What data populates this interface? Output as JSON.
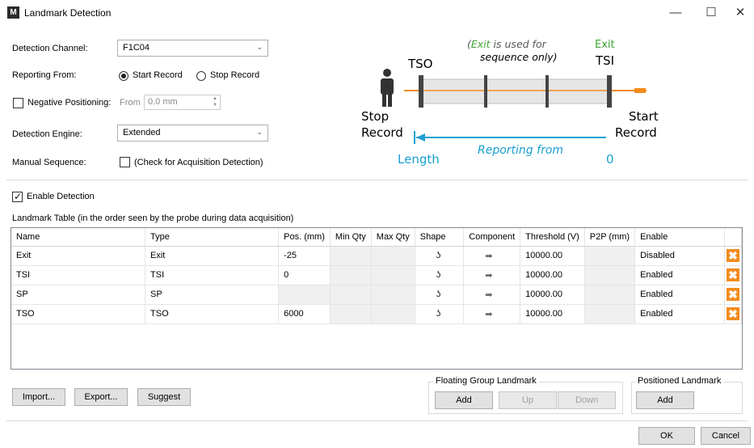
{
  "window": {
    "title": "Landmark Detection",
    "icon_glyph": "M",
    "controls": {
      "minimize": "—",
      "maximize": "☐",
      "close": "✕"
    }
  },
  "form": {
    "detection_channel": {
      "label": "Detection Channel:",
      "value": "F1C04"
    },
    "reporting_from": {
      "label": "Reporting From:",
      "options": [
        "Start Record",
        "Stop Record"
      ],
      "selected": "Start Record"
    },
    "negative_positioning": {
      "label": "Negative Positioning:",
      "checked": false,
      "from_label": "From",
      "value": "0.0 mm"
    },
    "detection_engine": {
      "label": "Detection Engine:",
      "value": "Extended"
    },
    "manual_sequence": {
      "label": "Manual Sequence:",
      "checkbox_label": "(Check for Acquisition Detection)",
      "checked": false
    }
  },
  "diagram": {
    "exit_note_1": "is used for",
    "exit_note_exit": "Exit",
    "exit_note_2": "sequence only)",
    "tso": "TSO",
    "tsi": "TSI",
    "exit": "Exit",
    "stop": "Stop",
    "stop_record": "Record",
    "start": "Start",
    "start_record": "Record",
    "reporting_from": "Reporting from",
    "length": "Length",
    "zero": "0",
    "colors": {
      "exit_green": "#3fa535",
      "cable_orange": "#f28b1e",
      "measure_blue": "#1a9fd0"
    }
  },
  "enable_detection": {
    "label": "Enable Detection",
    "checked": true
  },
  "table": {
    "caption": "Landmark Table (in the order seen by the probe during data acquisition)",
    "columns": [
      "Name",
      "Type",
      "Pos. (mm)",
      "Min Qty",
      "Max Qty",
      "Shape",
      "Component",
      "Threshold (V)",
      "P2P (mm)",
      "Enable"
    ],
    "rows": [
      {
        "name": "Exit",
        "type": "Exit",
        "pos": "-25",
        "min": "",
        "max": "",
        "threshold": "10000.00",
        "p2p": "",
        "enable": "Disabled"
      },
      {
        "name": "TSI",
        "type": "TSI",
        "pos": "0",
        "min": "",
        "max": "",
        "threshold": "10000.00",
        "p2p": "",
        "enable": "Enabled"
      },
      {
        "name": "SP",
        "type": "SP",
        "pos": "",
        "min": "",
        "max": "",
        "threshold": "10000.00",
        "p2p": "",
        "enable": "Enabled"
      },
      {
        "name": "TSO",
        "type": "TSO",
        "pos": "6000",
        "min": "",
        "max": "",
        "threshold": "10000.00",
        "p2p": "",
        "enable": "Enabled"
      }
    ],
    "shape_icon": "wave-shape-icon",
    "component_icon": "right-arrow-icon",
    "delete_icon": "delete-x-icon"
  },
  "buttons": {
    "import": "Import...",
    "export": "Export...",
    "suggest": "Suggest",
    "floating_group_title": "Floating Group Landmark",
    "floating_add": "Add",
    "floating_up": "Up",
    "floating_down": "Down",
    "positioned_title": "Positioned Landmark",
    "positioned_add": "Add",
    "ok": "OK",
    "cancel": "Cancel"
  }
}
